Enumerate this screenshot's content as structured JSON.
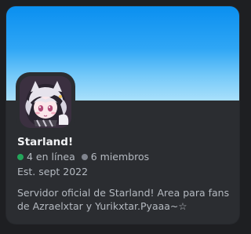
{
  "server": {
    "name": "Starland!",
    "online_text": "4 en línea",
    "members_text": "6 miembros",
    "established": "Est. sept 2022",
    "description": "Servidor oficial de Starland! Area para fans de Azraelxtar y Yurikxtar.Pyaaa~☆",
    "icon": "anime-character-avatar"
  },
  "colors": {
    "banner_top": "#0a8ff0",
    "banner_bottom": "#a9e0fb",
    "online": "#23a55a",
    "members": "#80848e"
  }
}
